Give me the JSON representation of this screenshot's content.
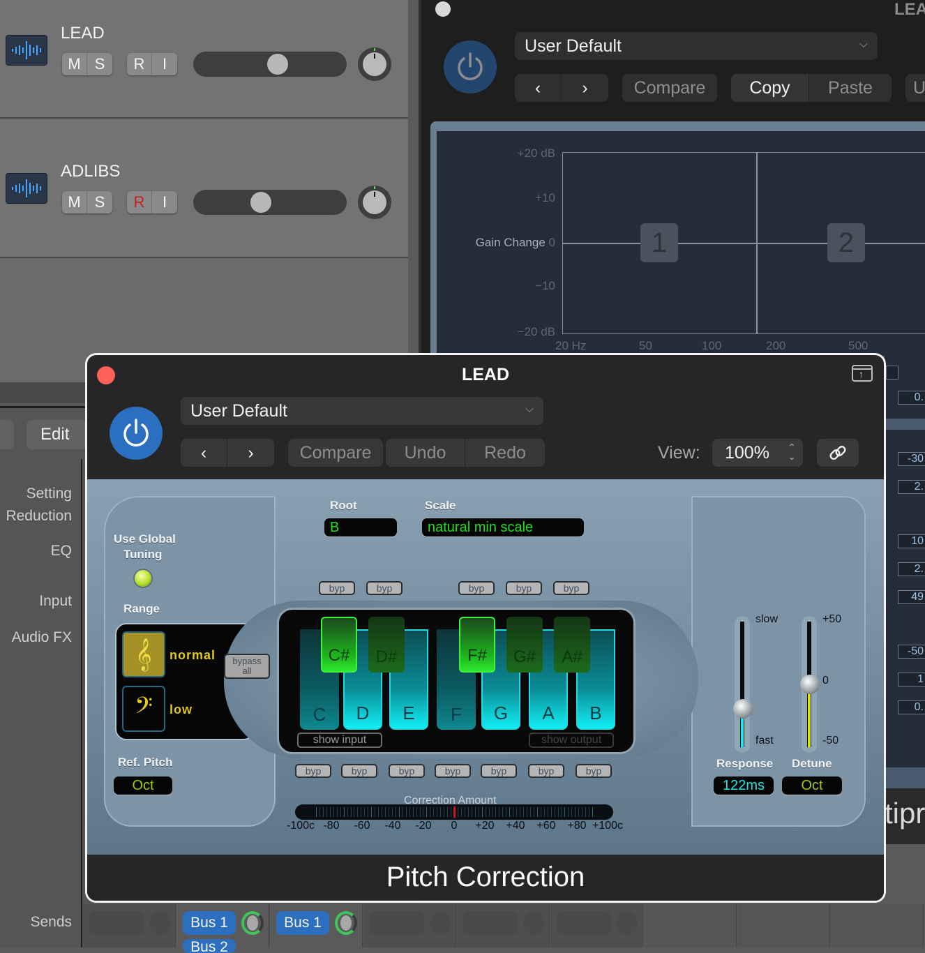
{
  "tracks": [
    {
      "name": "LEAD",
      "buttons": [
        "M",
        "S",
        "R",
        "I"
      ],
      "record_armed": false,
      "volume": 0.56,
      "pan": 0
    },
    {
      "name": "ADLIBS",
      "buttons": [
        "M",
        "S",
        "R",
        "I"
      ],
      "record_armed": true,
      "volume": 0.45,
      "pan": 0
    }
  ],
  "mixer": {
    "edit_label": "Edit",
    "side_labels": [
      "Setting",
      "Reduction",
      "EQ",
      "Input",
      "Audio FX"
    ],
    "sends_label": "Sends",
    "sends": [
      {
        "label": "Bus 1"
      },
      {
        "label": "Bus 1"
      },
      {
        "label": "Bus 2"
      }
    ]
  },
  "bg_plugin": {
    "title": "LEA",
    "preset": "User Default",
    "buttons": {
      "compare": "Compare",
      "copy": "Copy",
      "paste": "Paste",
      "prev": "‹",
      "next": "›"
    },
    "eq_graph": {
      "ylabel": "Gain Change",
      "yticks": [
        "+20 dB",
        "+10",
        "0",
        "−10",
        "−20 dB"
      ],
      "xticks": [
        "20 Hz",
        "50",
        "100",
        "200",
        "500"
      ],
      "bands": [
        "1",
        "2"
      ]
    },
    "right_values": [
      "0.",
      "-30",
      "2.",
      "10",
      "2.",
      "49",
      "-50",
      "1",
      "0."
    ],
    "right_tip": "tipr"
  },
  "plugin": {
    "title": "LEAD",
    "preset": "User Default",
    "buttons": {
      "prev": "‹",
      "next": "›",
      "compare": "Compare",
      "undo": "Undo",
      "redo": "Redo"
    },
    "view_label": "View:",
    "view_value": "100%",
    "name": "Pitch Correction",
    "root_label": "Root",
    "root_value": "B",
    "scale_label": "Scale",
    "scale_value": "natural min scale",
    "global_tuning_label_1": "Use Global",
    "global_tuning_label_2": "Tuning",
    "range_label": "Range",
    "range_options": [
      {
        "label": "normal",
        "icon": "treble-clef",
        "active": true
      },
      {
        "label": "low",
        "icon": "bass-clef",
        "active": false
      }
    ],
    "ref_pitch_label": "Ref. Pitch",
    "ref_pitch_value": "Oct",
    "bypass_all_1": "bypass",
    "bypass_all_2": "all",
    "byp_label": "byp",
    "white_keys": [
      {
        "note": "C",
        "in_scale": false
      },
      {
        "note": "D",
        "in_scale": true
      },
      {
        "note": "E",
        "in_scale": true
      },
      {
        "note": "F",
        "in_scale": false
      },
      {
        "note": "G",
        "in_scale": true
      },
      {
        "note": "A",
        "in_scale": true
      },
      {
        "note": "B",
        "in_scale": true
      }
    ],
    "black_keys": [
      {
        "note": "C#",
        "in_scale": true
      },
      {
        "note": "D#",
        "in_scale": false
      },
      {
        "note": "F#",
        "in_scale": true
      },
      {
        "note": "G#",
        "in_scale": false
      },
      {
        "note": "A#",
        "in_scale": false
      }
    ],
    "show_input": "show input",
    "show_output": "show output",
    "correction_label": "Correction Amount",
    "correction_scale": [
      "-100c",
      "-80",
      "-60",
      "-40",
      "-20",
      "0",
      "+20",
      "+40",
      "+60",
      "+80",
      "+100c"
    ],
    "correction_value": 0,
    "response": {
      "label": "Response",
      "top": "slow",
      "bottom": "fast",
      "value": "122ms",
      "position": 0.28
    },
    "detune": {
      "label": "Detune",
      "top": "+50",
      "mid": "0",
      "bottom": "-50",
      "value": "Oct",
      "position": 0.5
    }
  }
}
